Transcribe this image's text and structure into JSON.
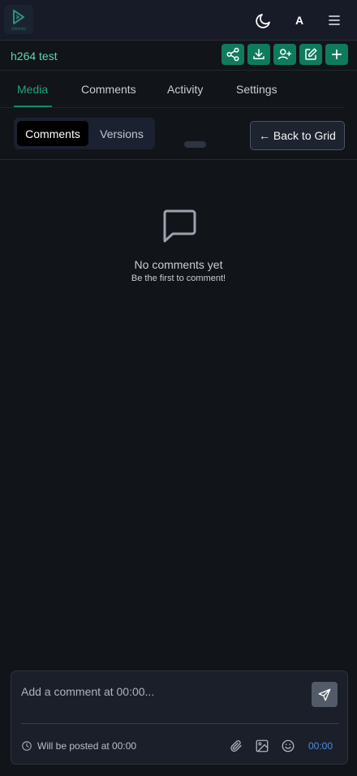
{
  "header": {
    "logo_icon": "play-logo-icon",
    "logo_text": "Glimmie",
    "theme_icon": "moon-icon",
    "font_button_label": "A",
    "menu_icon": "hamburger-menu-icon"
  },
  "project": {
    "title": "h264 test",
    "actions": [
      {
        "name": "share",
        "icon": "share-icon"
      },
      {
        "name": "download",
        "icon": "download-icon"
      },
      {
        "name": "add-user",
        "icon": "user-plus-icon"
      },
      {
        "name": "edit",
        "icon": "edit-icon"
      },
      {
        "name": "add",
        "icon": "plus-icon"
      }
    ]
  },
  "tabs": [
    {
      "label": "Media",
      "active": true
    },
    {
      "label": "Comments",
      "active": false
    },
    {
      "label": "Activity",
      "active": false
    },
    {
      "label": "Settings",
      "active": false
    }
  ],
  "toolbar": {
    "segments": [
      {
        "label": "Comments",
        "active": true
      },
      {
        "label": "Versions",
        "active": false
      }
    ],
    "back_label": "← Back to Grid"
  },
  "empty_state": {
    "icon": "speech-bubble-icon",
    "title": "No comments yet",
    "subtitle": "Be the first to comment!"
  },
  "composer": {
    "placeholder": "Add a comment at 00:00...",
    "send_icon": "send-icon",
    "post_info": "Will be posted at 00:00",
    "timecode": "00:00",
    "tools": [
      "paperclip-icon",
      "image-icon",
      "smile-icon"
    ]
  },
  "colors": {
    "accent": "#0f7a5e",
    "accent_text": "#5fd4b8",
    "background": "#111419",
    "timecode": "#4a8fe6"
  }
}
